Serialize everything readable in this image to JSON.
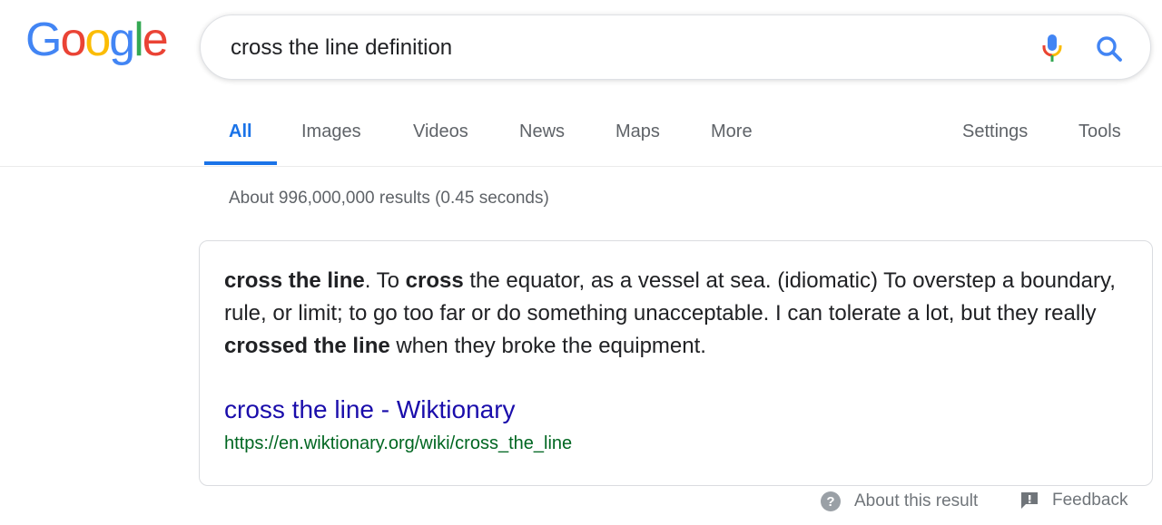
{
  "logo": {
    "letters": [
      "G",
      "o",
      "o",
      "g",
      "l",
      "e"
    ],
    "colors": [
      "#4285f4",
      "#ea4335",
      "#fbbc05",
      "#4285f4",
      "#34a853",
      "#ea4335"
    ]
  },
  "search": {
    "value": "cross the line definition",
    "mic_icon": "microphone-icon",
    "search_icon": "magnifier-icon"
  },
  "tabs": [
    {
      "label": "All",
      "active": true
    },
    {
      "label": "Images"
    },
    {
      "label": "Videos"
    },
    {
      "label": "News"
    },
    {
      "label": "Maps"
    },
    {
      "label": "More"
    }
  ],
  "tools": {
    "settings_label": "Settings",
    "tools_label": "Tools"
  },
  "result_stats": "About 996,000,000 results (0.45 seconds)",
  "card": {
    "definition": {
      "part1_bold": "cross the line",
      "part2": ". To ",
      "part3_bold": "cross",
      "part4": " the equator, as a vessel at sea. (idiomatic) To overstep a boundary, rule, or limit; to go too far or do something unacceptable. I can tolerate a lot, but they really ",
      "part5_bold": "crossed the line",
      "part6": " when they broke the equipment."
    },
    "title": "cross the line - Wiktionary",
    "url": "https://en.wiktionary.org/wiki/cross_the_line"
  },
  "footer": {
    "about_label": "About this result",
    "feedback_label": "Feedback"
  },
  "colors": {
    "accent": "#1a73e8",
    "link": "#1a0dab",
    "url_green": "#006621"
  }
}
